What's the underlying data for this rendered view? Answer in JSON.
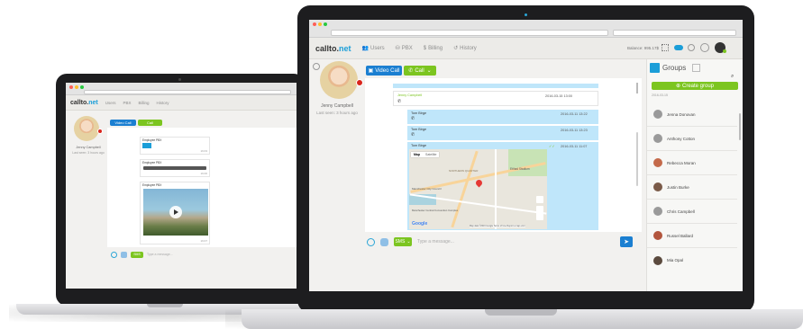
{
  "app": {
    "logo_main": "callto.",
    "logo_accent": "net",
    "nav": [
      "Users",
      "PBX",
      "Billing",
      "History"
    ],
    "balance_label": "Balance: 995.17$"
  },
  "contact": {
    "name": "Jenny Campbell",
    "last_seen": "Last seen: 3 hours ago"
  },
  "toolbar": {
    "video_call": "Video Call",
    "call": "Call"
  },
  "messages_main": [
    {
      "sender": "Jenny Campbell",
      "time": "2016-03-15 13:00"
    },
    {
      "sender": "Tom Birge",
      "time": "2016-03-11 13:22"
    },
    {
      "sender": "Tom Birge",
      "time": "2016-03-11 13:23"
    },
    {
      "sender": "Tom Birge",
      "time": "2016-03-11 11:07"
    }
  ],
  "map": {
    "tab_map": "Map",
    "tab_satellite": "Satellite",
    "labels": [
      "NORTHERN QUARTER",
      "Etihad Stadium",
      "Manchester City Council",
      "Manchester Central Convention Complex",
      "Google",
      "Map data ©2016 Google",
      "Terms of Use",
      "Report a map error"
    ]
  },
  "composer": {
    "sms_label": "SMS",
    "placeholder": "Type a message..."
  },
  "groups": {
    "title": "Groups",
    "create_label": "Create group",
    "date": "2016-03-15",
    "contacts": [
      "Jenna Donovan",
      "Anthony Cotton",
      "Rebecca Moran",
      "Justin Burke",
      "Chris Campbell",
      "Russel Ballard",
      "Mia Opal"
    ]
  },
  "left_laptop": {
    "messages": [
      {
        "sender": "Employee PBX",
        "time": "16:03"
      },
      {
        "sender": "Employee PBX",
        "time": "16:06"
      },
      {
        "sender": "Employee PBX",
        "time": "16:07"
      }
    ]
  }
}
